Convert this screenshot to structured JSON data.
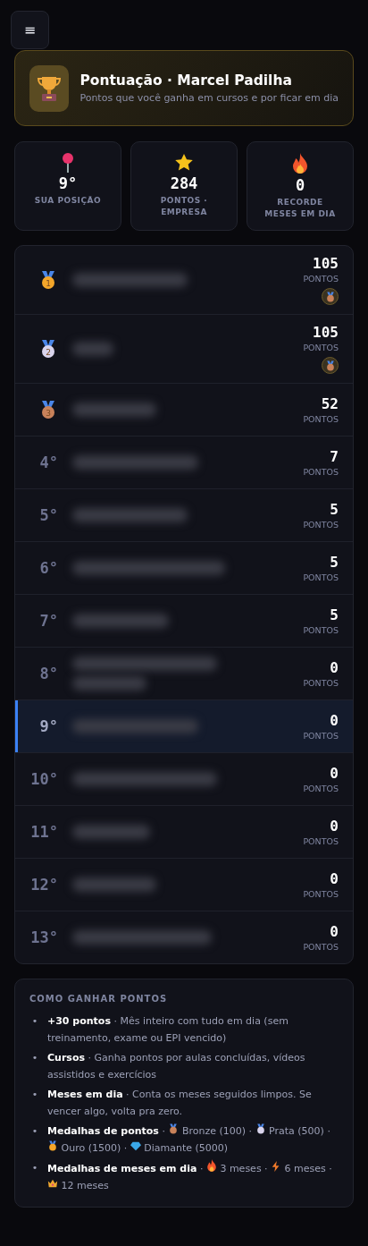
{
  "menu_button": {
    "label": "≡"
  },
  "header": {
    "title": "Pontuação · Marcel Padilha",
    "subtitle": "Pontos que você ganha em cursos e por ficar em dia"
  },
  "stats": [
    {
      "kind": "pin",
      "value": "9°",
      "label": "SUA POSIÇÃO"
    },
    {
      "kind": "star",
      "value": "284",
      "label": "PONTOS · EMPRESA"
    },
    {
      "kind": "fire",
      "value": "0",
      "label": "RECORDE MESES EM DIA"
    }
  ],
  "ranking": [
    {
      "kind": "gold",
      "rank": "1",
      "points": "105",
      "unit": "PONTOS",
      "badge": true,
      "selected": false,
      "wrapped": false
    },
    {
      "kind": "silver",
      "rank": "2",
      "points": "105",
      "unit": "PONTOS",
      "badge": true,
      "selected": false,
      "wrapped": false
    },
    {
      "kind": "bronze",
      "rank": "3",
      "points": "52",
      "unit": "PONTOS",
      "badge": false,
      "selected": false,
      "wrapped": false
    },
    {
      "kind": "plain",
      "rank": "4°",
      "points": "7",
      "unit": "PONTOS",
      "badge": false,
      "selected": false,
      "wrapped": false
    },
    {
      "kind": "plain",
      "rank": "5°",
      "points": "5",
      "unit": "PONTOS",
      "badge": false,
      "selected": false,
      "wrapped": false
    },
    {
      "kind": "plain",
      "rank": "6°",
      "points": "5",
      "unit": "PONTOS",
      "badge": false,
      "selected": false,
      "wrapped": false
    },
    {
      "kind": "plain",
      "rank": "7°",
      "points": "5",
      "unit": "PONTOS",
      "badge": false,
      "selected": false,
      "wrapped": false
    },
    {
      "kind": "plain",
      "rank": "8°",
      "points": "0",
      "unit": "PONTOS",
      "badge": false,
      "selected": false,
      "wrapped": true
    },
    {
      "kind": "plain",
      "rank": "9°",
      "points": "0",
      "unit": "PONTOS",
      "badge": false,
      "selected": true,
      "wrapped": false
    },
    {
      "kind": "plain",
      "rank": "10°",
      "points": "0",
      "unit": "PONTOS",
      "badge": false,
      "selected": false,
      "wrapped": false
    },
    {
      "kind": "plain",
      "rank": "11°",
      "points": "0",
      "unit": "PONTOS",
      "badge": false,
      "selected": false,
      "wrapped": false
    },
    {
      "kind": "plain",
      "rank": "12°",
      "points": "0",
      "unit": "PONTOS",
      "badge": false,
      "selected": false,
      "wrapped": false
    },
    {
      "kind": "plain",
      "rank": "13°",
      "points": "0",
      "unit": "PONTOS",
      "badge": false,
      "selected": false,
      "wrapped": false
    }
  ],
  "how_to": {
    "title": "COMO GANHAR PONTOS",
    "items": [
      {
        "bullet": "•",
        "kind": "sentence",
        "text": "**+30 pontos** · Mês inteiro com tudo em dia (sem treinamento, exame ou EPI vencido)"
      },
      {
        "bullet": "•",
        "kind": "sentence",
        "text": "**Cursos** · Ganha pontos por aulas concluídas, vídeos assistidos e exercícios"
      },
      {
        "bullet": "•",
        "kind": "sentence",
        "text": "**Meses em dia** · Conta os meses seguidos limpos. Se vencer algo, volta pra zero."
      },
      {
        "bullet": "•",
        "kind": "icons",
        "term": "Medalhas de pontos",
        "segments": [
          {
            "kind": "text",
            "text": "·"
          },
          {
            "kind": "bronze",
            "text": "Bronze (100) ·"
          },
          {
            "kind": "silver",
            "text": "Prata (500) ·"
          },
          {
            "kind": "gold",
            "text": "Ouro (1500) ·"
          },
          {
            "kind": "diamond",
            "text": "Diamante (5000)"
          }
        ]
      },
      {
        "bullet": "•",
        "kind": "icons",
        "term": "Medalhas de meses em dia",
        "segments": [
          {
            "kind": "text",
            "text": "·"
          },
          {
            "kind": "fire",
            "text": "3 meses ·"
          },
          {
            "kind": "bolt",
            "text": "6 meses ·"
          },
          {
            "kind": "crown",
            "text": "12 meses"
          }
        ]
      }
    ]
  }
}
